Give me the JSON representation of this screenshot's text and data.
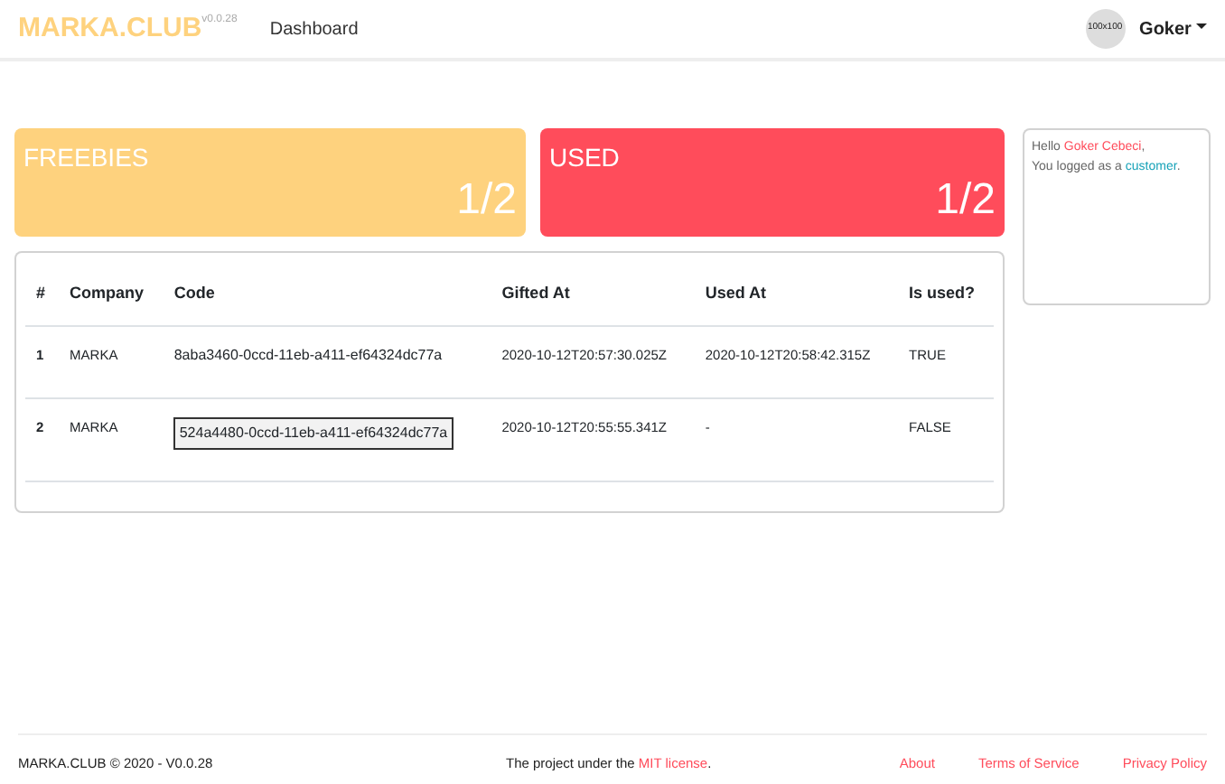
{
  "navbar": {
    "brand": "MARKA.CLUB",
    "version": "v0.0.28",
    "links": [
      {
        "label": "Dashboard"
      }
    ],
    "avatar": "100x100",
    "user": "Goker"
  },
  "stats": [
    {
      "title": "FREEBIES",
      "value": "1/2",
      "color": "#fed27e"
    },
    {
      "title": "USED",
      "value": "1/2",
      "color": "#ff4c5b"
    }
  ],
  "table": {
    "columns": [
      "#",
      "Company",
      "Code",
      "Gifted At",
      "Used At",
      "Is used?"
    ],
    "rows": [
      {
        "cells": [
          "1",
          "MARKA",
          "8aba3460-0ccd-11eb-a411-ef64324dc77a",
          "2020-10-12T20:57:30.025Z",
          "2020-10-12T20:58:42.315Z",
          "TRUE"
        ],
        "selected": false
      },
      {
        "cells": [
          "2",
          "MARKA",
          "524a4480-0ccd-11eb-a411-ef64324dc77a",
          "2020-10-12T20:55:55.341Z",
          "-",
          "FALSE"
        ],
        "selected": true
      }
    ]
  },
  "welcome": {
    "hello": "Hello",
    "name": "Goker Cebeci",
    "comma": ",",
    "role_prefix": "You logged as a",
    "role": "customer",
    "period": "."
  },
  "footer": {
    "copyright": "MARKA.CLUB © 2020 - V0.0.28",
    "project_prefix": "The project under the",
    "license": "MIT license",
    "period": ".",
    "links": [
      "About",
      "Terms of Service",
      "Privacy Policy"
    ]
  }
}
